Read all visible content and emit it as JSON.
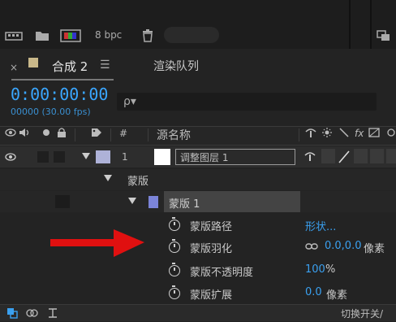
{
  "toolbar": {
    "bpc_label": "8 bpc"
  },
  "tabs": {
    "close": "×",
    "comp_title": "合成 2",
    "menu": "☰",
    "render_queue": "渲染队列"
  },
  "time": {
    "timecode": "0:00:00:00",
    "frames": "00000 (30.00 fps)"
  },
  "search": {
    "icon": "ρ▾"
  },
  "columns": {
    "number": "#",
    "source_name": "源名称"
  },
  "layer": {
    "number": "1",
    "name": "调整图层 1",
    "color": "#aeb2d8"
  },
  "mask_group": {
    "label": "蒙版"
  },
  "mask": {
    "label": "蒙版 1",
    "color": "#7b84d8"
  },
  "properties": [
    {
      "label": "蒙版路径",
      "value": "形状...",
      "unit": ""
    },
    {
      "label": "蒙版羽化",
      "value": "0.0,0.0",
      "unit": "像素"
    },
    {
      "label": "蒙版不透明度",
      "value": "100",
      "unit": "%"
    },
    {
      "label": "蒙版扩展",
      "value": "0.0",
      "unit": "像素"
    }
  ],
  "footer": {
    "toggle_label": "切换开关/"
  },
  "colors": {
    "accent": "#3aa6ff",
    "arrow": "#e01010"
  }
}
